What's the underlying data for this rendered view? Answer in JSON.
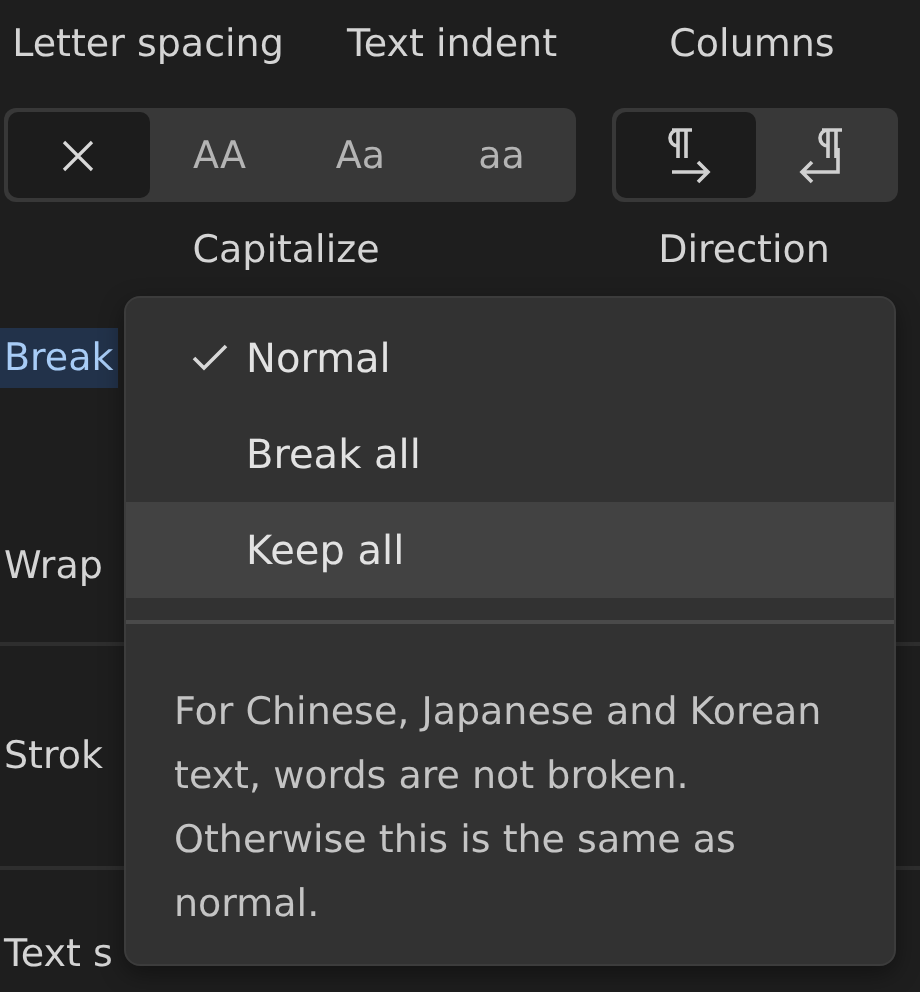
{
  "headers": [
    "Letter spacing",
    "Text indent",
    "Columns"
  ],
  "capitalize": {
    "caption": "Capitalize",
    "options": [
      {
        "kind": "none",
        "selected": true
      },
      {
        "kind": "text",
        "label": "AA",
        "selected": false
      },
      {
        "kind": "text",
        "label": "Aa",
        "selected": false
      },
      {
        "kind": "text",
        "label": "aa",
        "selected": false
      }
    ]
  },
  "direction": {
    "caption": "Direction",
    "options": [
      {
        "kind": "ltr",
        "selected": true
      },
      {
        "kind": "rtl",
        "selected": false
      }
    ]
  },
  "sections": [
    {
      "rows": [
        {
          "label": "Break",
          "highlighted": true
        },
        {
          "label": "Wrap",
          "highlighted": false
        }
      ]
    },
    {
      "rows": [
        {
          "label": "Strok",
          "highlighted": false
        }
      ]
    },
    {
      "rows": [
        {
          "label": "Text s",
          "highlighted": false
        }
      ]
    }
  ],
  "dropdown": {
    "options": [
      {
        "label": "Normal",
        "checked": true,
        "hovered": false
      },
      {
        "label": "Break all",
        "checked": false,
        "hovered": false
      },
      {
        "label": "Keep all",
        "checked": false,
        "hovered": true
      }
    ],
    "description": "For Chinese, Japanese and Korean text, words are not broken. Otherwise this is the same as normal."
  }
}
